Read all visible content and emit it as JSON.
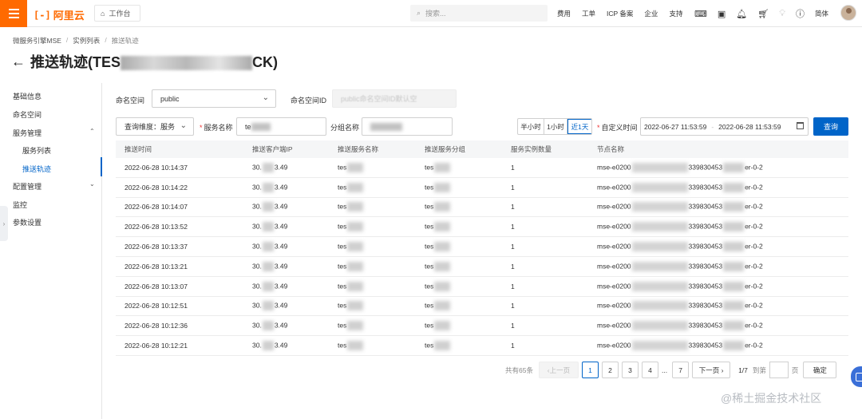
{
  "topbar": {
    "logo_text": "阿里云",
    "workbench_label": "工作台",
    "search_placeholder": "搜索...",
    "nav_links": [
      "费用",
      "工单",
      "ICP 备案",
      "企业",
      "支持"
    ],
    "lang_label": "简体",
    "icons": [
      "terminal-icon",
      "image-icon",
      "bell-icon",
      "cart-icon",
      "lightbulb-icon",
      "help-icon"
    ]
  },
  "breadcrumb": [
    "微服务引擎MSE",
    "实例列表",
    "推送轨迹"
  ],
  "page_title": {
    "arrow": "←",
    "prefix": "推送轨迹(TES",
    "suffix": "CK)"
  },
  "sidebar": {
    "items": [
      {
        "label": "基础信息"
      },
      {
        "label": "命名空间"
      },
      {
        "label": "服务管理",
        "expanded": true
      },
      {
        "label": "服务列表",
        "sub": true
      },
      {
        "label": "推送轨迹",
        "sub": true,
        "active": true
      },
      {
        "label": "配置管理",
        "expanded": false
      },
      {
        "label": "监控"
      },
      {
        "label": "参数设置"
      }
    ]
  },
  "filters": {
    "namespace_label": "命名空间",
    "namespace_value": "public",
    "namespace_id_label": "命名空间ID",
    "namespace_id_placeholder": "public命名空间ID默认空",
    "dimension_value": "查询维度：服务",
    "service_name_label": "服务名称",
    "service_name_value": "te",
    "group_name_label": "分组名称",
    "group_name_value": "",
    "time_options": [
      "半小时",
      "1小时",
      "近1天"
    ],
    "time_selected": "近1天",
    "custom_time_label": "自定义时间",
    "start_time": "2022-06-27 11:53:59",
    "end_time": "2022-06-28 11:53:59",
    "query_label": "查询"
  },
  "table": {
    "headers": [
      "推送时间",
      "推送客户端IP",
      "推送服务名称",
      "推送服务分组",
      "服务实例数量",
      "节点名称"
    ],
    "rows": [
      {
        "time": "2022-06-28 10:14:37",
        "ip_pre": "30.",
        "ip_post": "3.49",
        "svc": "tes",
        "grp": "tes",
        "count": "1",
        "node_pre": "mse-e0200",
        "node_mid": "339830453",
        "node_post": "er-0-2"
      },
      {
        "time": "2022-06-28 10:14:22",
        "ip_pre": "30.",
        "ip_post": "3.49",
        "svc": "tes",
        "grp": "tes",
        "count": "1",
        "node_pre": "mse-e0200",
        "node_mid": "339830453",
        "node_post": "er-0-2"
      },
      {
        "time": "2022-06-28 10:14:07",
        "ip_pre": "30.",
        "ip_post": "3.49",
        "svc": "tes",
        "grp": "tes",
        "count": "1",
        "node_pre": "mse-e0200",
        "node_mid": "339830453",
        "node_post": "er-0-2"
      },
      {
        "time": "2022-06-28 10:13:52",
        "ip_pre": "30.",
        "ip_post": "3.49",
        "svc": "tes",
        "grp": "tes",
        "count": "1",
        "node_pre": "mse-e0200",
        "node_mid": "339830453",
        "node_post": "er-0-2"
      },
      {
        "time": "2022-06-28 10:13:37",
        "ip_pre": "30.",
        "ip_post": "3.49",
        "svc": "tes",
        "grp": "tes",
        "count": "1",
        "node_pre": "mse-e0200",
        "node_mid": "339830453",
        "node_post": "er-0-2"
      },
      {
        "time": "2022-06-28 10:13:21",
        "ip_pre": "30.",
        "ip_post": "3.49",
        "svc": "tes",
        "grp": "tes",
        "count": "1",
        "node_pre": "mse-e0200",
        "node_mid": "339830453",
        "node_post": "er-0-2"
      },
      {
        "time": "2022-06-28 10:13:07",
        "ip_pre": "30.",
        "ip_post": "3.49",
        "svc": "tes",
        "grp": "tes",
        "count": "1",
        "node_pre": "mse-e0200",
        "node_mid": "339830453",
        "node_post": "er-0-2"
      },
      {
        "time": "2022-06-28 10:12:51",
        "ip_pre": "30.",
        "ip_post": "3.49",
        "svc": "tes",
        "grp": "tes",
        "count": "1",
        "node_pre": "mse-e0200",
        "node_mid": "339830453",
        "node_post": "er-0-2"
      },
      {
        "time": "2022-06-28 10:12:36",
        "ip_pre": "30.",
        "ip_post": "3.49",
        "svc": "tes",
        "grp": "tes",
        "count": "1",
        "node_pre": "mse-e0200",
        "node_mid": "339830453",
        "node_post": "er-0-2"
      },
      {
        "time": "2022-06-28 10:12:21",
        "ip_pre": "30.",
        "ip_post": "3.49",
        "svc": "tes",
        "grp": "tes",
        "count": "1",
        "node_pre": "mse-e0200",
        "node_mid": "339830453",
        "node_post": "er-0-2"
      }
    ]
  },
  "pagination": {
    "total": "共有65条",
    "prev": "上一页",
    "pages": [
      "1",
      "2",
      "3",
      "4",
      "...",
      "7"
    ],
    "current": "1",
    "next": "下一页",
    "page_of": "1/7",
    "jump_label": "到第",
    "page_unit": "页",
    "confirm": "确定"
  },
  "watermark": "@稀土掘金技术社区",
  "colors": {
    "brand": "#ff6a00",
    "primary": "#0064c8"
  }
}
